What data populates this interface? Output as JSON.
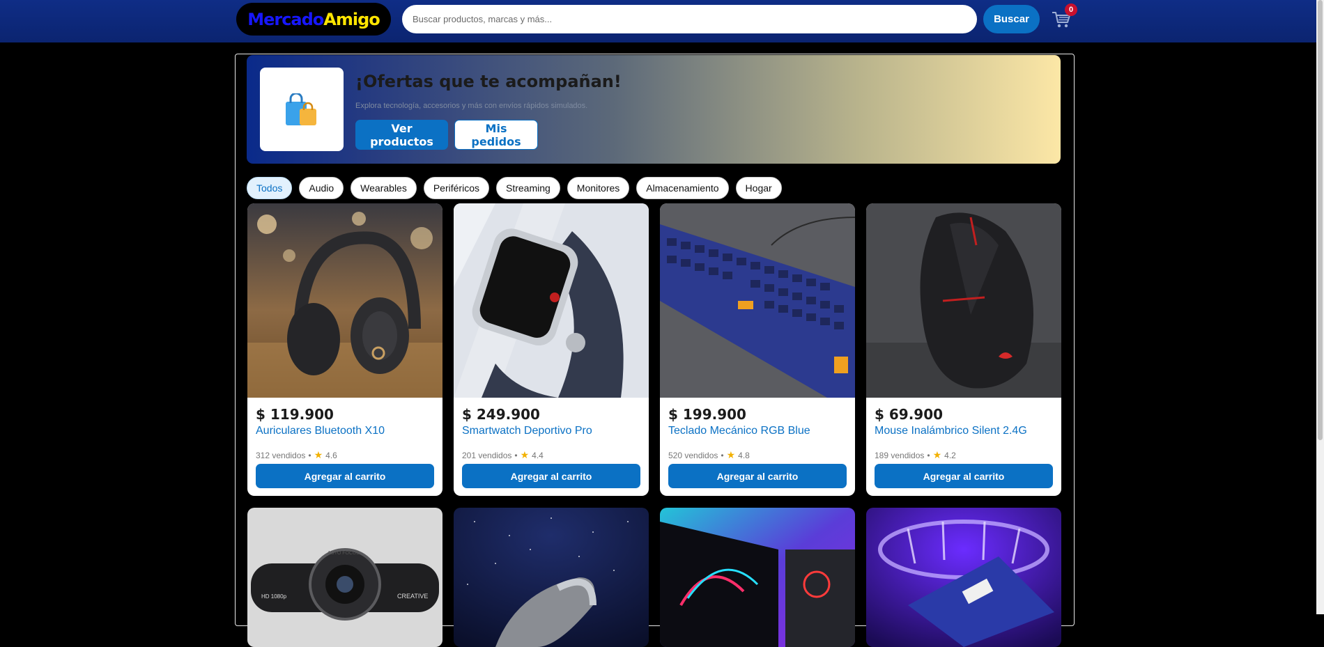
{
  "header": {
    "logo_part1": "Mercado",
    "logo_part2": "Amigo",
    "search_placeholder": "Buscar productos, marcas y más...",
    "search_button": "Buscar",
    "cart_icon": "cart-icon",
    "cart_count": "0"
  },
  "hero": {
    "title": "¡Ofertas que te acompañan!",
    "subtitle": "Explora tecnología, accesorios y más con envíos rápidos simulados.",
    "btn_products": "Ver productos",
    "btn_orders": "Mis pedidos",
    "icon": "shopping-bags-icon"
  },
  "categories": [
    "Todos",
    "Audio",
    "Wearables",
    "Periféricos",
    "Streaming",
    "Monitores",
    "Almacenamiento",
    "Hogar"
  ],
  "active_category": "Todos",
  "products": [
    {
      "price": "$ 119.900",
      "name": "Auriculares Bluetooth X10",
      "sold": "312 vendidos",
      "rating": "4.6",
      "image": "headphones-image",
      "button": "Agregar al carrito"
    },
    {
      "price": "$ 249.900",
      "name": "Smartwatch Deportivo Pro",
      "sold": "201 vendidos",
      "rating": "4.4",
      "image": "smartwatch-image",
      "button": "Agregar al carrito"
    },
    {
      "price": "$ 199.900",
      "name": "Teclado Mecánico RGB Blue",
      "sold": "520 vendidos",
      "rating": "4.8",
      "image": "keyboard-image",
      "button": "Agregar al carrito"
    },
    {
      "price": "$ 69.900",
      "name": "Mouse Inalámbrico Silent 2.4G",
      "sold": "189 vendidos",
      "rating": "4.2",
      "image": "mouse-image",
      "button": "Agregar al carrito"
    }
  ],
  "products_row2": [
    {
      "image": "webcam-image",
      "webcam_label_left": "HD 1080p",
      "webcam_label_top": "AUTO FOCUS",
      "webcam_label_right": "CREATIVE"
    },
    {
      "image": "speaker-image"
    },
    {
      "image": "monitor-image"
    },
    {
      "image": "ssd-image"
    }
  ],
  "colors": {
    "header_bg": "#0f2d86",
    "accent": "#0b71c4",
    "logo_blue": "#1717ff",
    "logo_yellow": "#ffe500",
    "star": "#f2b100",
    "badge": "#c8102e"
  }
}
